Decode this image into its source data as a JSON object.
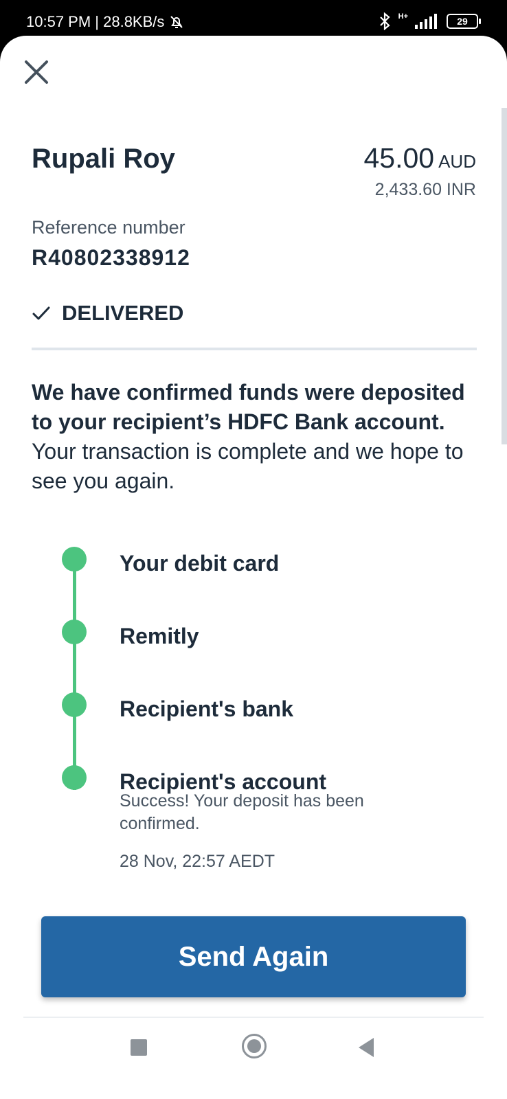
{
  "status_bar": {
    "time_speed": "10:57 PM | 28.8KB/s",
    "network": "H+",
    "battery": "29"
  },
  "transfer": {
    "recipient_name": "Rupali Roy",
    "amount": "45.00",
    "currency": "AUD",
    "converted_amount": "2,433.60 INR",
    "reference_label": "Reference number",
    "reference_number": "R40802338912",
    "status": "DELIVERED"
  },
  "message": {
    "bold": "We have confirmed funds were deposited to your recipient’s HDFC Bank account.",
    "regular": " Your transaction is complete and we hope to see you again."
  },
  "timeline": {
    "steps": [
      {
        "label": "Your debit card"
      },
      {
        "label": "Remitly"
      },
      {
        "label": "Recipient's bank"
      },
      {
        "label": "Recipient's account"
      }
    ],
    "final_description": "Success! Your deposit has been confirmed.",
    "final_time": "28 Nov, 22:57 AEDT"
  },
  "actions": {
    "send_again": "Send Again"
  },
  "colors": {
    "accent": "#2467a5",
    "success": "#4cc47f",
    "text": "#1d2b3a"
  }
}
